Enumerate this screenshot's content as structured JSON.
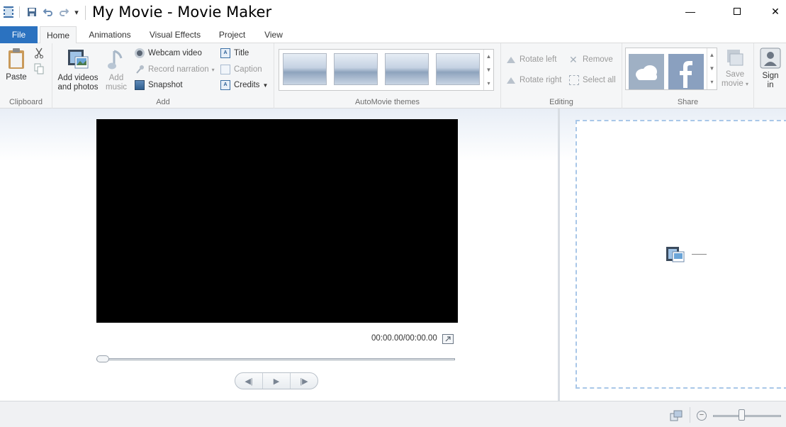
{
  "window": {
    "title": "My Movie - Movie Maker",
    "minimize_glyph": "—",
    "maximize_glyph": "☐",
    "close_glyph": "✕"
  },
  "quick_access": {
    "customize_glyph": "▾"
  },
  "tabs": [
    {
      "label": "File"
    },
    {
      "label": "Home"
    },
    {
      "label": "Animations"
    },
    {
      "label": "Visual Effects"
    },
    {
      "label": "Project"
    },
    {
      "label": "View"
    }
  ],
  "ribbon": {
    "clipboard": {
      "label": "Clipboard",
      "paste": "Paste"
    },
    "add": {
      "label": "Add",
      "add_videos_line1": "Add videos",
      "add_videos_line2": "and photos",
      "add_music_line1": "Add",
      "add_music_line2": "music",
      "webcam": "Webcam video",
      "record_narration": "Record narration",
      "snapshot": "Snapshot",
      "title": "Title",
      "caption": "Caption",
      "credits": "Credits"
    },
    "themes": {
      "label": "AutoMovie themes"
    },
    "editing": {
      "label": "Editing",
      "rotate_left": "Rotate left",
      "rotate_right": "Rotate right",
      "remove": "Remove",
      "select_all": "Select all"
    },
    "share": {
      "label": "Share",
      "save_movie_line1": "Save",
      "save_movie_line2": "movie"
    },
    "account": {
      "sign_in_line1": "Sign",
      "sign_in_line2": "in"
    }
  },
  "player": {
    "timecode": "00:00.00/00:00.00",
    "progress": 0,
    "prev_frame": "◀|",
    "play": "▶",
    "next_frame": "|▶"
  },
  "statusbar": {
    "zoom_out_glyph": "−",
    "zoom_level": 0.42
  },
  "colors": {
    "file_tab": "#2b72c0",
    "ribbon_bg": "#f5f6f7",
    "storyboard_border": "#a9c7e8"
  }
}
